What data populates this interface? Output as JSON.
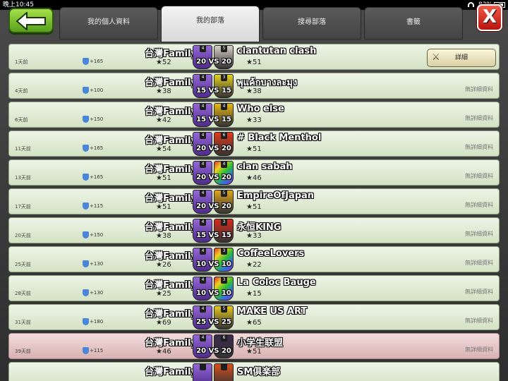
{
  "status_bar": {
    "time": "晚上10:45",
    "battery": "83%"
  },
  "header": {
    "tabs": [
      {
        "label": "我的個人資料",
        "active": false
      },
      {
        "label": "我的部落",
        "active": true
      },
      {
        "label": "搜尋部落",
        "active": false
      },
      {
        "label": "書籤",
        "active": false
      }
    ]
  },
  "my_clan_name": "台灣Family",
  "detail_button_label": "詳細",
  "no_detail_text": "無詳細資料",
  "colors": {
    "win_row": "#dde9d2",
    "loss_row": "#e6c5c5",
    "my_badge": "#6b44b0"
  },
  "wars": [
    {
      "ago": "1天前",
      "trophies": "+165",
      "my_stars": "52",
      "score": "20 VS 20",
      "my_level": "4",
      "opp_level": "5",
      "opp_badge_color": "#d8d2c8",
      "opponent": "clantutan clash",
      "opp_stars": "51",
      "result": "win",
      "has_detail": true
    },
    {
      "ago": "4天前",
      "trophies": "+100",
      "my_stars": "38",
      "score": "15 VS 15",
      "my_level": "4",
      "opp_level": "3",
      "opp_badge_color": "#e6d21e",
      "opponent": "พุแค้กบางละมุง",
      "opp_stars": "38",
      "result": "win",
      "has_detail": false
    },
    {
      "ago": "6天前",
      "trophies": "+150",
      "my_stars": "42",
      "score": "15 VS 15",
      "my_level": "4",
      "opp_level": "4",
      "opp_badge_color": "#e8b814",
      "opponent": "Who else",
      "opp_stars": "33",
      "result": "win",
      "has_detail": false
    },
    {
      "ago": "11天前",
      "trophies": "+165",
      "my_stars": "54",
      "score": "20 VS 20",
      "my_level": "4",
      "opp_level": "6",
      "opp_badge_color": "#e23a1c",
      "opponent": "# Black Menthol",
      "opp_stars": "51",
      "result": "win",
      "has_detail": false
    },
    {
      "ago": "13天前",
      "trophies": "+165",
      "my_stars": "51",
      "score": "20 VS 20",
      "my_level": "4",
      "opp_level": "4",
      "opp_badge_color": "rainbow",
      "opponent": "clan sabah",
      "opp_stars": "46",
      "result": "win",
      "has_detail": false
    },
    {
      "ago": "17天前",
      "trophies": "+115",
      "my_stars": "51",
      "score": "20 VS 20",
      "my_level": "4",
      "opp_level": "5",
      "opp_badge_color": "#e0a51c",
      "opponent": "EmpireOfJapan",
      "opp_stars": "51",
      "result": "win",
      "has_detail": false
    },
    {
      "ago": "20天前",
      "trophies": "+150",
      "my_stars": "38",
      "score": "15 VS 15",
      "my_level": "4",
      "opp_level": "3",
      "opp_badge_color": "#d62a1c",
      "opponent": "永恒KING",
      "opp_stars": "33",
      "result": "win",
      "has_detail": false
    },
    {
      "ago": "25天前",
      "trophies": "+130",
      "my_stars": "26",
      "score": "10 VS 10",
      "my_level": "4",
      "opp_level": "3",
      "opp_badge_color": "rainbow",
      "opponent": "CoffeeLovers",
      "opp_stars": "22",
      "result": "win",
      "has_detail": false
    },
    {
      "ago": "28天前",
      "trophies": "+130",
      "my_stars": "25",
      "score": "10 VS 10",
      "my_level": "4",
      "opp_level": "3",
      "opp_badge_color": "rainbow",
      "opponent": "La Coloc Bauge",
      "opp_stars": "15",
      "result": "win",
      "has_detail": false
    },
    {
      "ago": "31天前",
      "trophies": "+180",
      "my_stars": "69",
      "score": "25 VS 25",
      "my_level": "4",
      "opp_level": "5",
      "opp_badge_color": "#e6c81e",
      "opponent": "MAKE US ART",
      "opp_stars": "65",
      "result": "win",
      "has_detail": false
    },
    {
      "ago": "39天前",
      "trophies": "+115",
      "my_stars": "46",
      "score": "20 VS 20",
      "my_level": "4",
      "opp_level": "6",
      "opp_badge_color": "#3a2a4a",
      "opponent": "小学生联盟",
      "opp_stars": "51",
      "result": "loss",
      "has_detail": false
    },
    {
      "ago": "",
      "trophies": "",
      "my_stars": "",
      "score": "",
      "my_level": "",
      "opp_level": "",
      "opp_badge_color": "#d8501c",
      "opponent": "SM俱楽部",
      "opp_stars": "",
      "result": "win",
      "has_detail": false
    }
  ]
}
